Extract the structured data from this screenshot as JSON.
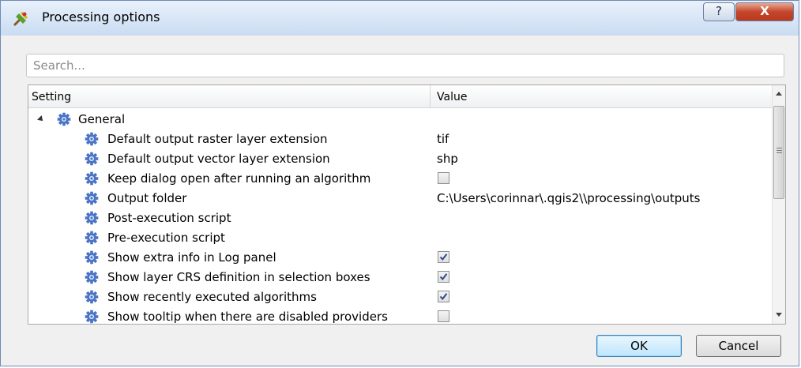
{
  "window": {
    "title": "Processing options",
    "help_label": "?",
    "close_label": "X"
  },
  "search": {
    "placeholder": "Search..."
  },
  "table": {
    "columns": [
      "Setting",
      "Value"
    ],
    "group": "General",
    "rows": [
      {
        "label": "Default output raster layer extension",
        "value": "tif"
      },
      {
        "label": "Default output vector layer extension",
        "value": "shp"
      },
      {
        "label": "Keep dialog open after running an algorithm",
        "checkbox": false
      },
      {
        "label": "Output folder",
        "value": "C:\\Users\\corinnar\\.qgis2\\\\processing\\outputs"
      },
      {
        "label": "Post-execution script",
        "value": ""
      },
      {
        "label": "Pre-execution script",
        "value": ""
      },
      {
        "label": "Show extra info in Log panel",
        "checkbox": true
      },
      {
        "label": "Show layer CRS definition in selection boxes",
        "checkbox": true
      },
      {
        "label": "Show recently executed algorithms",
        "checkbox": true
      },
      {
        "label": "Show tooltip when there are disabled providers",
        "checkbox": false
      }
    ]
  },
  "buttons": {
    "ok": "OK",
    "cancel": "Cancel"
  },
  "colors": {
    "gear": "#4a74c4",
    "check": "#2e4a8a"
  },
  "icons": {
    "app": "qgis-processing-icon",
    "setting": "gear-icon"
  }
}
